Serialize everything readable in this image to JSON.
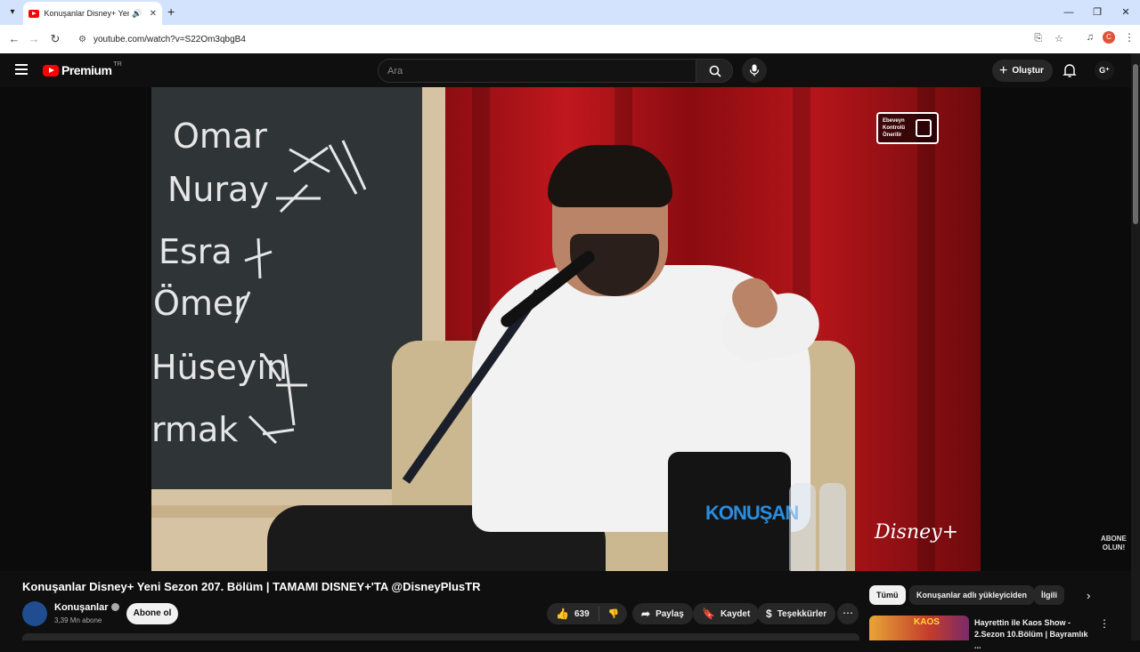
{
  "browser": {
    "tab_title": "Konuşanlar Disney+ Yeni Se",
    "url": "youtube.com/watch?v=S22Om3qbgB4",
    "profile_initial": "C"
  },
  "header": {
    "logo_text": "Premium",
    "country": "TR",
    "search_placeholder": "Ara",
    "create_label": "Oluştur"
  },
  "video": {
    "rating_badge": [
      "Ebeveyn",
      "Kontrolü",
      "Önerilir"
    ],
    "cup_brand": "KONUŞAN",
    "disney_logo": "Disney+",
    "subscribe_overlay": [
      "ABONE",
      "OLUN!"
    ],
    "board_names": [
      "Omar",
      "Nuray",
      "Esra",
      "Ömer",
      "Hüseyin",
      "rmak"
    ]
  },
  "info": {
    "title": "Konuşanlar Disney+ Yeni Sezon 207. Bölüm | TAMAMI DISNEY+'TA @DisneyPlusTR",
    "channel_name": "Konuşanlar",
    "subscribers": "3,39 Mn abone",
    "subscribe_label": "Abone ol",
    "likes": "639",
    "share_label": "Paylaş",
    "save_label": "Kaydet",
    "thanks_label": "Teşekkürler"
  },
  "sidebar": {
    "chips": [
      "Tümü",
      "Konuşanlar adlı yükleyiciden",
      "İlgili"
    ],
    "rec_title": "Hayrettin ile Kaos Show - 2.Sezon 10.Bölüm | Bayramlık ...",
    "rec_thumb_text": "KAOS"
  }
}
